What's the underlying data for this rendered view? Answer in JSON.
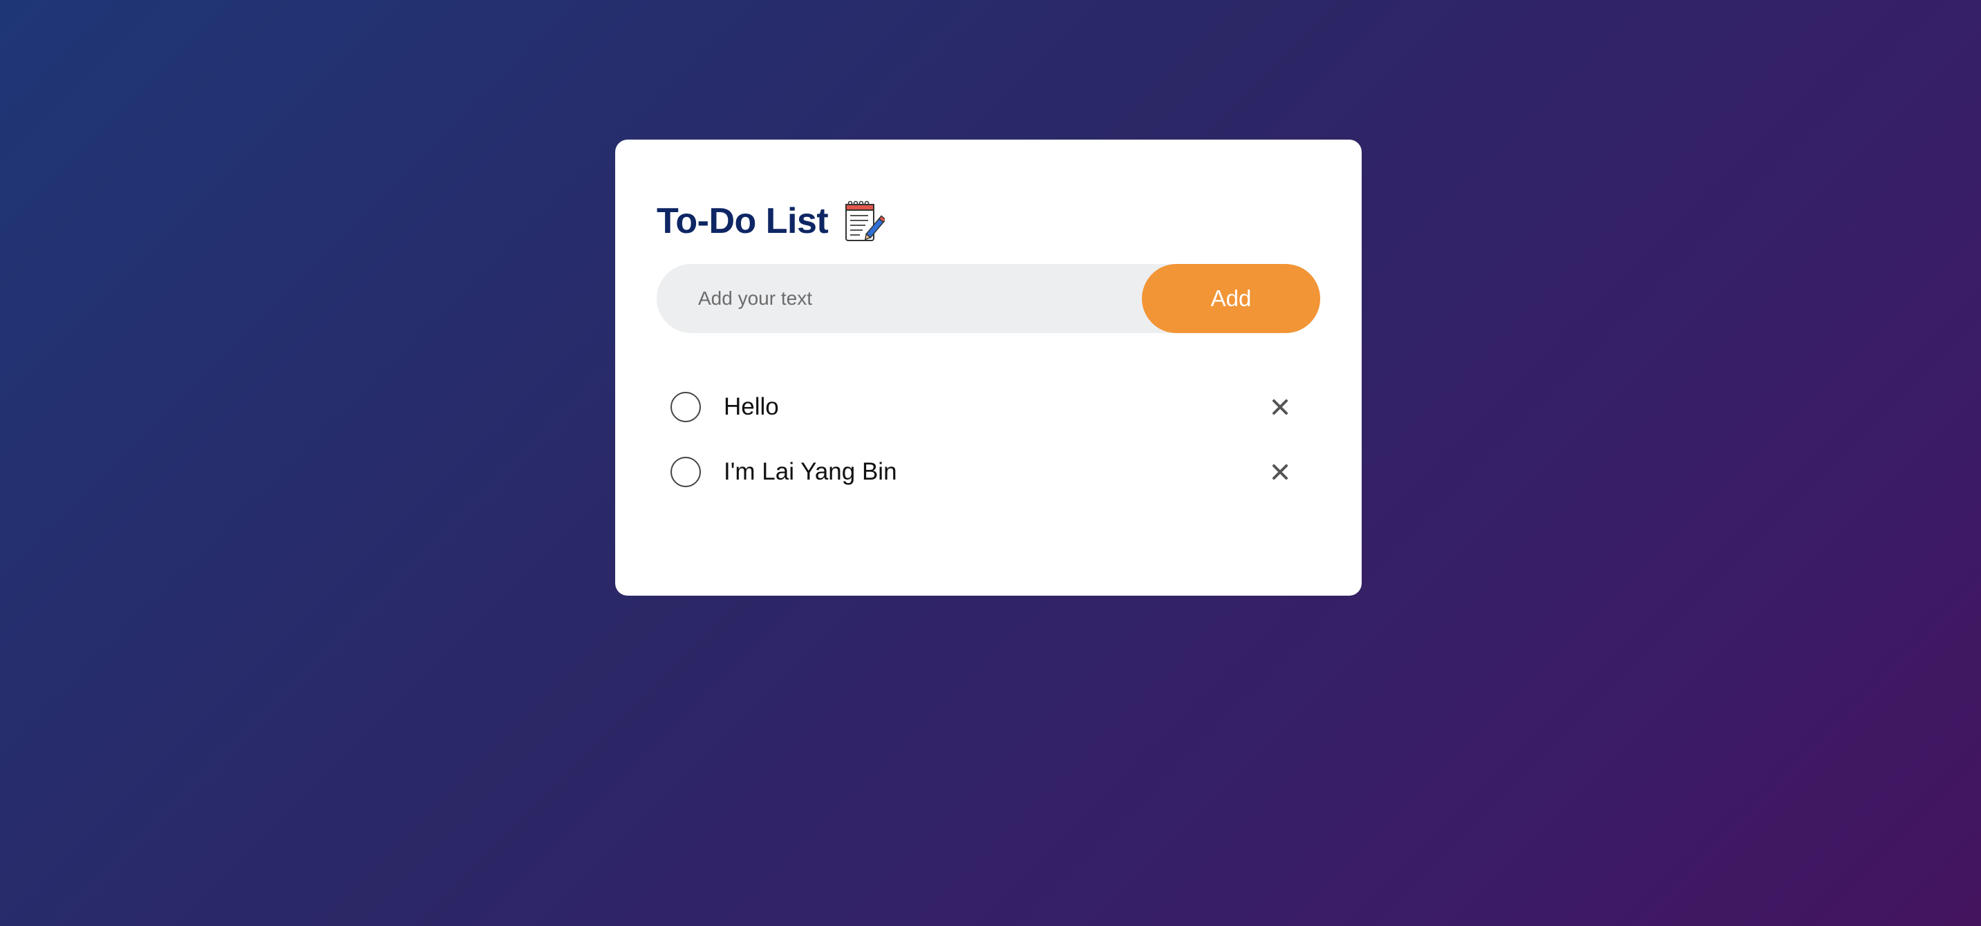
{
  "app": {
    "title": "To-Do List",
    "title_icon": "notepad-icon"
  },
  "input": {
    "value": "",
    "placeholder": "Add your text"
  },
  "add_button": {
    "label": "Add"
  },
  "todos": [
    {
      "text": "Hello",
      "checked": false
    },
    {
      "text": "I'm Lai Yang Bin",
      "checked": false
    }
  ],
  "icons": {
    "item_check": "empty-circle-icon",
    "item_delete": "close-icon"
  },
  "colors": {
    "title": "#0e2664",
    "accent": "#f29536",
    "input_bg": "#edeef0",
    "delete_icon": "#555555"
  }
}
